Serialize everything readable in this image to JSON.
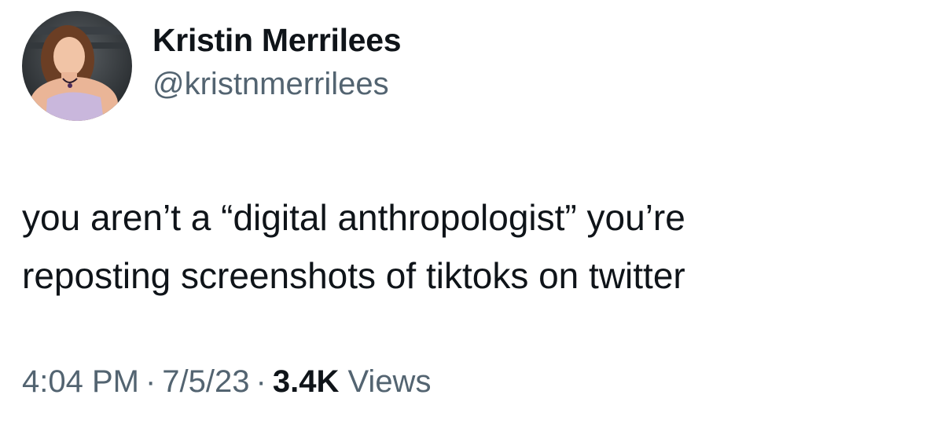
{
  "author": {
    "display_name": "Kristin Merrilees",
    "handle": "@kristnmerrilees"
  },
  "tweet": {
    "lines": [
      "you aren’t a “digital anthropologist” you’re",
      "reposting screenshots of tiktoks on twitter"
    ]
  },
  "meta": {
    "time": "4:04 PM",
    "separator": "·",
    "date": "7/5/23",
    "views_count": "3.4K",
    "views_label": "Views"
  },
  "colors": {
    "text_primary": "#0f1419",
    "text_secondary": "#536471",
    "background": "#ffffff"
  }
}
